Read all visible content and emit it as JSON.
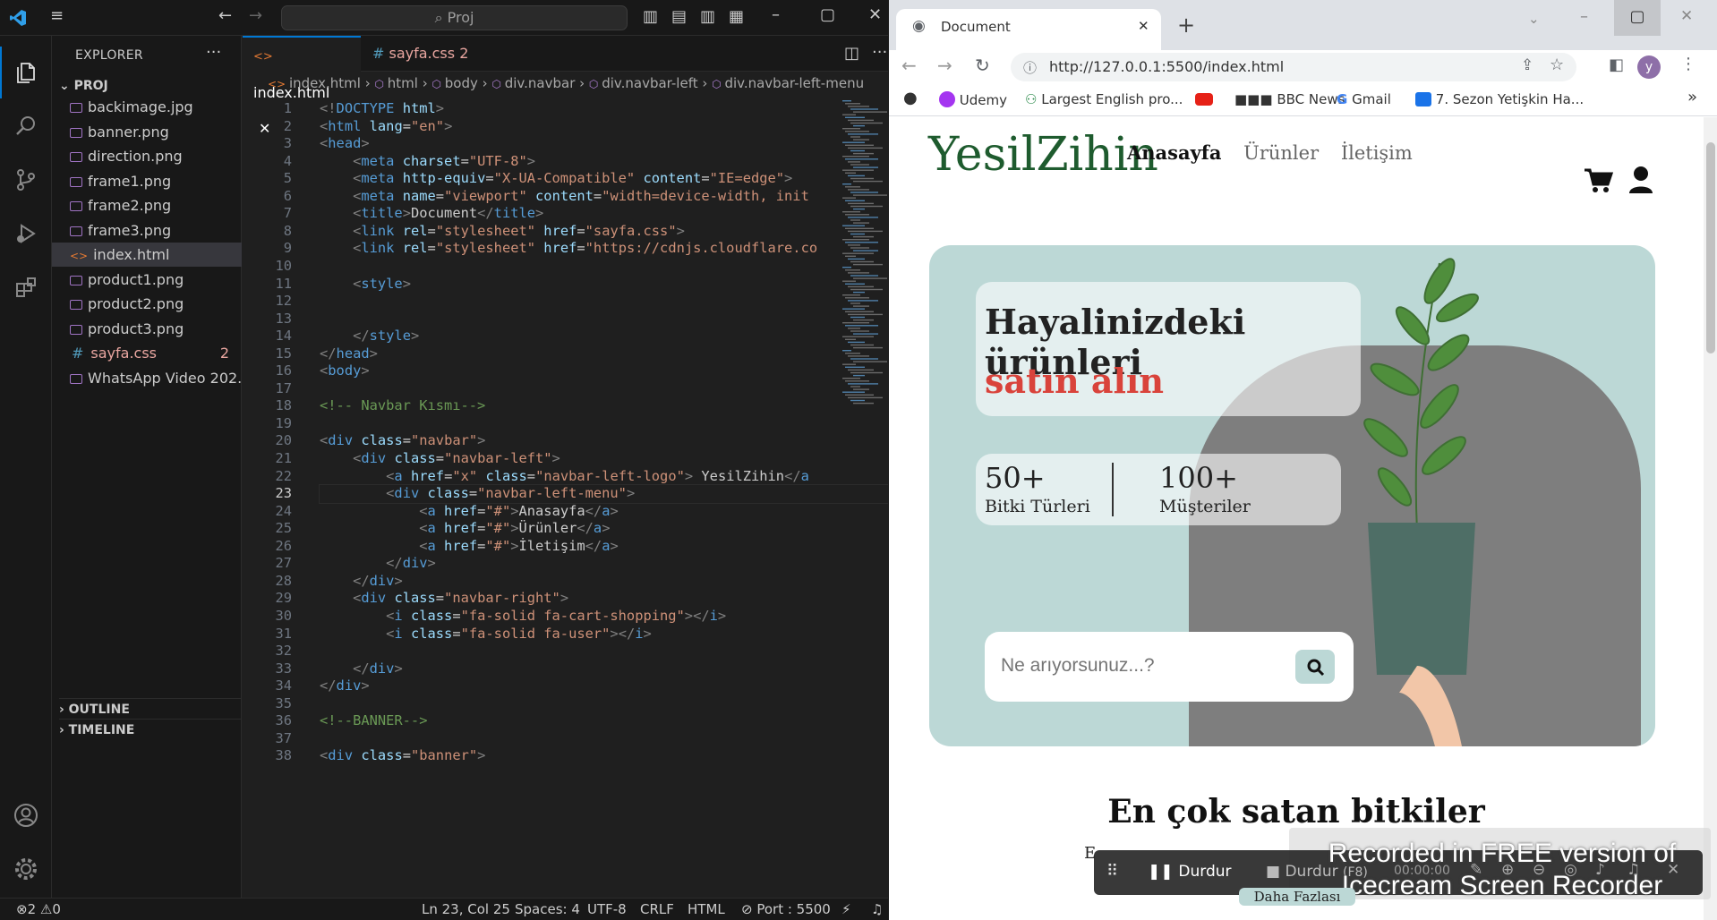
{
  "vscode": {
    "search_placeholder": "Proj",
    "explorer_title": "EXPLORER",
    "project_title": "PROJ",
    "files": [
      {
        "name": "backimage.jpg",
        "kind": "image"
      },
      {
        "name": "banner.png",
        "kind": "image"
      },
      {
        "name": "direction.png",
        "kind": "image"
      },
      {
        "name": "frame1.png",
        "kind": "image"
      },
      {
        "name": "frame2.png",
        "kind": "image"
      },
      {
        "name": "frame3.png",
        "kind": "image"
      },
      {
        "name": "index.html",
        "kind": "html",
        "selected": true
      },
      {
        "name": "product1.png",
        "kind": "image"
      },
      {
        "name": "product2.png",
        "kind": "image"
      },
      {
        "name": "product3.png",
        "kind": "image"
      },
      {
        "name": "sayfa.css",
        "kind": "css",
        "badge": "2"
      },
      {
        "name": "WhatsApp Video 202...",
        "kind": "image"
      }
    ],
    "outline_label": "OUTLINE",
    "timeline_label": "TIMELINE",
    "tabs": [
      {
        "label": "index.html",
        "icon": "<>",
        "active": true
      },
      {
        "label": "sayfa.css 2",
        "icon": "#",
        "active": false
      }
    ],
    "breadcrumbs": [
      "index.html",
      "html",
      "body",
      "div.navbar",
      "div.navbar-left",
      "div.navbar-left-menu"
    ],
    "current_line": 23,
    "code_lines": [
      "<!DOCTYPE html>",
      "<html lang=\"en\">",
      "<head>",
      "    <meta charset=\"UTF-8\">",
      "    <meta http-equiv=\"X-UA-Compatible\" content=\"IE=edge\">",
      "    <meta name=\"viewport\" content=\"width=device-width, init",
      "    <title>Document</title>",
      "    <link rel=\"stylesheet\" href=\"sayfa.css\">",
      "    <link rel=\"stylesheet\" href=\"https://cdnjs.cloudflare.co",
      "",
      "    <style>",
      "",
      "",
      "    </style>",
      "</head>",
      "<body>",
      "",
      "<!-- Navbar Kısmı-->",
      "",
      "<div class=\"navbar\">",
      "    <div class=\"navbar-left\">",
      "        <a href=\"x\" class=\"navbar-left-logo\"> YesilZihin</a",
      "        <div class=\"navbar-left-menu\">",
      "            <a href=\"#\">Anasayfa</a>",
      "            <a href=\"#\">Ürünler</a>",
      "            <a href=\"#\">İletişim</a>",
      "        </div>",
      "    </div>",
      "    <div class=\"navbar-right\">",
      "        <i class=\"fa-solid fa-cart-shopping\"></i>",
      "        <i class=\"fa-solid fa-user\"></i>",
      "",
      "    </div>",
      "</div>",
      "",
      "<!--BANNER-->",
      "",
      "<div class=\"banner\">"
    ],
    "status": {
      "errors": "2",
      "warnings": "0",
      "position": "Ln 23, Col 25",
      "spaces": "Spaces: 4",
      "encoding": "UTF-8",
      "eol": "CRLF",
      "language": "HTML",
      "port": "Port : 5500"
    },
    "colors": {
      "accent": "#0078d4",
      "bg": "#1f1f1f",
      "tag": "#569cd6",
      "attr": "#9cdcfe",
      "string": "#ce9178",
      "comment": "#6a9955"
    }
  },
  "browser": {
    "tab_title": "Document",
    "url": "http://127.0.0.1:5500/index.html",
    "profile_initial": "y",
    "bookmarks": [
      "Udemy",
      "Largest English pro...",
      "BBC News",
      "Gmail",
      "7. Sezon Yetişkin Ha..."
    ],
    "site": {
      "logo": "YesilZihin",
      "menu": [
        "Anasayfa",
        "Ürünler",
        "İletişim"
      ],
      "hero_line1": "Hayalinizdeki ürünleri",
      "hero_line2": "satın alın",
      "stats": [
        {
          "value": "50+",
          "label": "Bitki Türleri"
        },
        {
          "value": "100+",
          "label": "Müşteriler"
        }
      ],
      "search_placeholder": "Ne arıyorsunuz...?",
      "section_title": "En çok satan bitkiler",
      "section_sub": "E",
      "more_label": "Daha Fazlası"
    },
    "colors": {
      "logo": "#1e5b2e",
      "accent_red": "#d9433b",
      "banner_bg": "#bcd8d6",
      "blob": "#7e7e7e"
    }
  },
  "recorder": {
    "pause_label": "Durdur",
    "stop_label": "Durdur",
    "stop_hint": "(F8)",
    "time": "00:00:00",
    "watermark": "Recorded in FREE version of Icecream Screen Recorder"
  }
}
